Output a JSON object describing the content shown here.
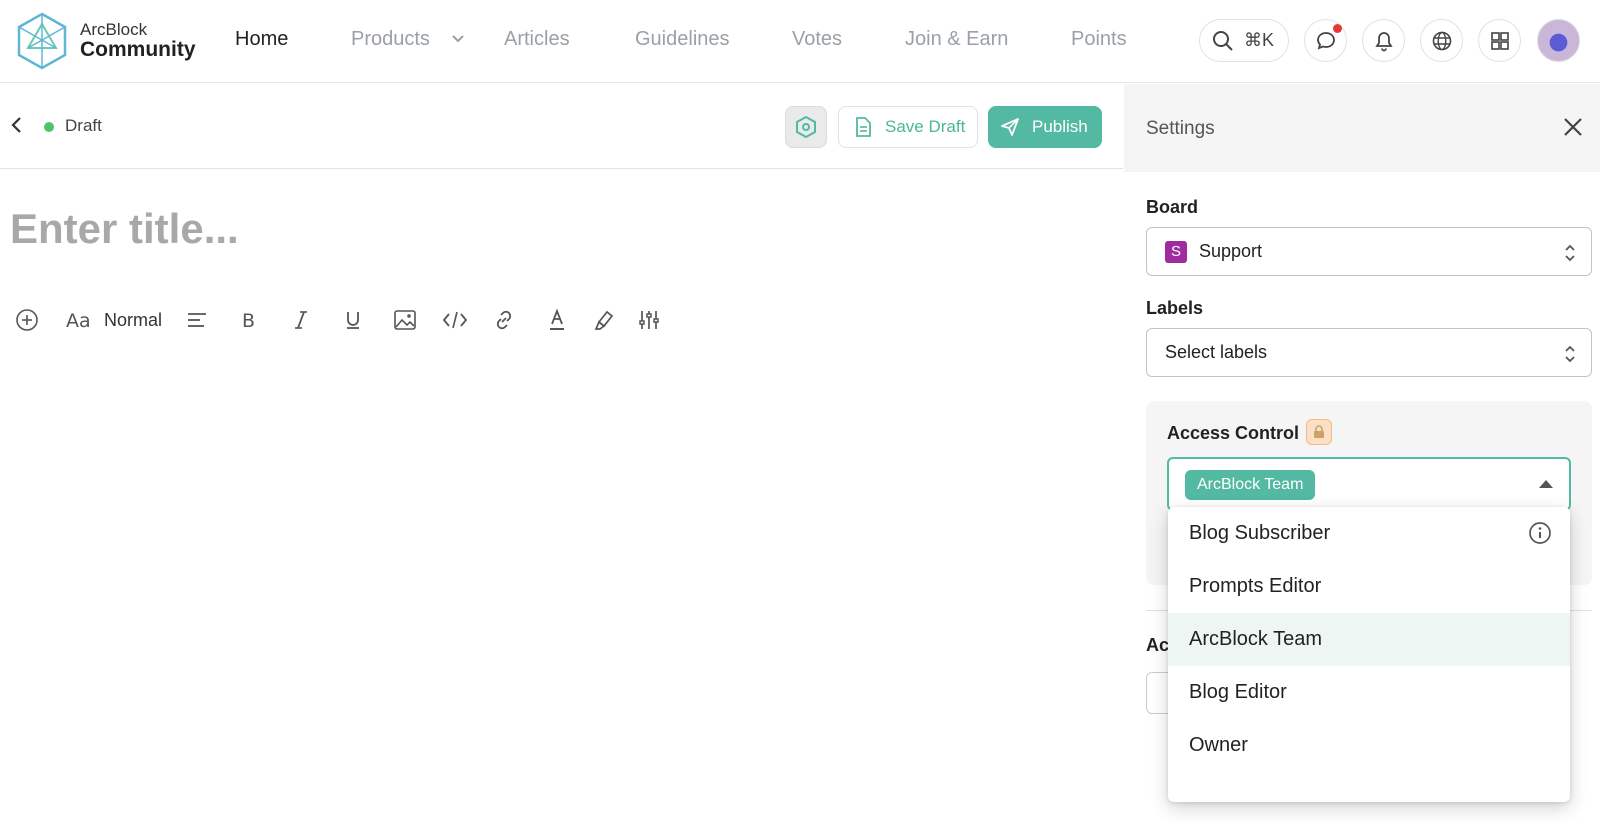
{
  "app": {
    "logo_top": "ArcBlock",
    "logo_bottom": "Community"
  },
  "nav": {
    "items": [
      {
        "label": "Home"
      },
      {
        "label": "Products"
      },
      {
        "label": "Articles"
      },
      {
        "label": "Guidelines"
      },
      {
        "label": "Votes"
      },
      {
        "label": "Join & Earn"
      },
      {
        "label": "Points"
      }
    ],
    "search_shortcut": "⌘K"
  },
  "editor": {
    "status": "Draft",
    "save_label": "Save Draft",
    "publish_label": "Publish",
    "title_placeholder": "Enter title...",
    "format_label": "Normal"
  },
  "settings": {
    "title": "Settings",
    "board_label": "Board",
    "board_badge": "S",
    "board_value": "Support",
    "labels_label": "Labels",
    "labels_placeholder": "Select labels",
    "access_title": "Access Control",
    "access_selected": "ArcBlock Team",
    "ac_label": "Ac"
  },
  "dropdown": {
    "options": [
      {
        "label": "Blog Subscriber"
      },
      {
        "label": "Prompts Editor"
      },
      {
        "label": "ArcBlock Team"
      },
      {
        "label": "Blog Editor"
      },
      {
        "label": "Owner"
      }
    ],
    "highlighted": "ArcBlock Team"
  },
  "colors": {
    "accent": "#53b9a2",
    "board_badge": "#a02aa0",
    "status_dot": "#4cc46a",
    "notification_dot": "#e53935"
  }
}
